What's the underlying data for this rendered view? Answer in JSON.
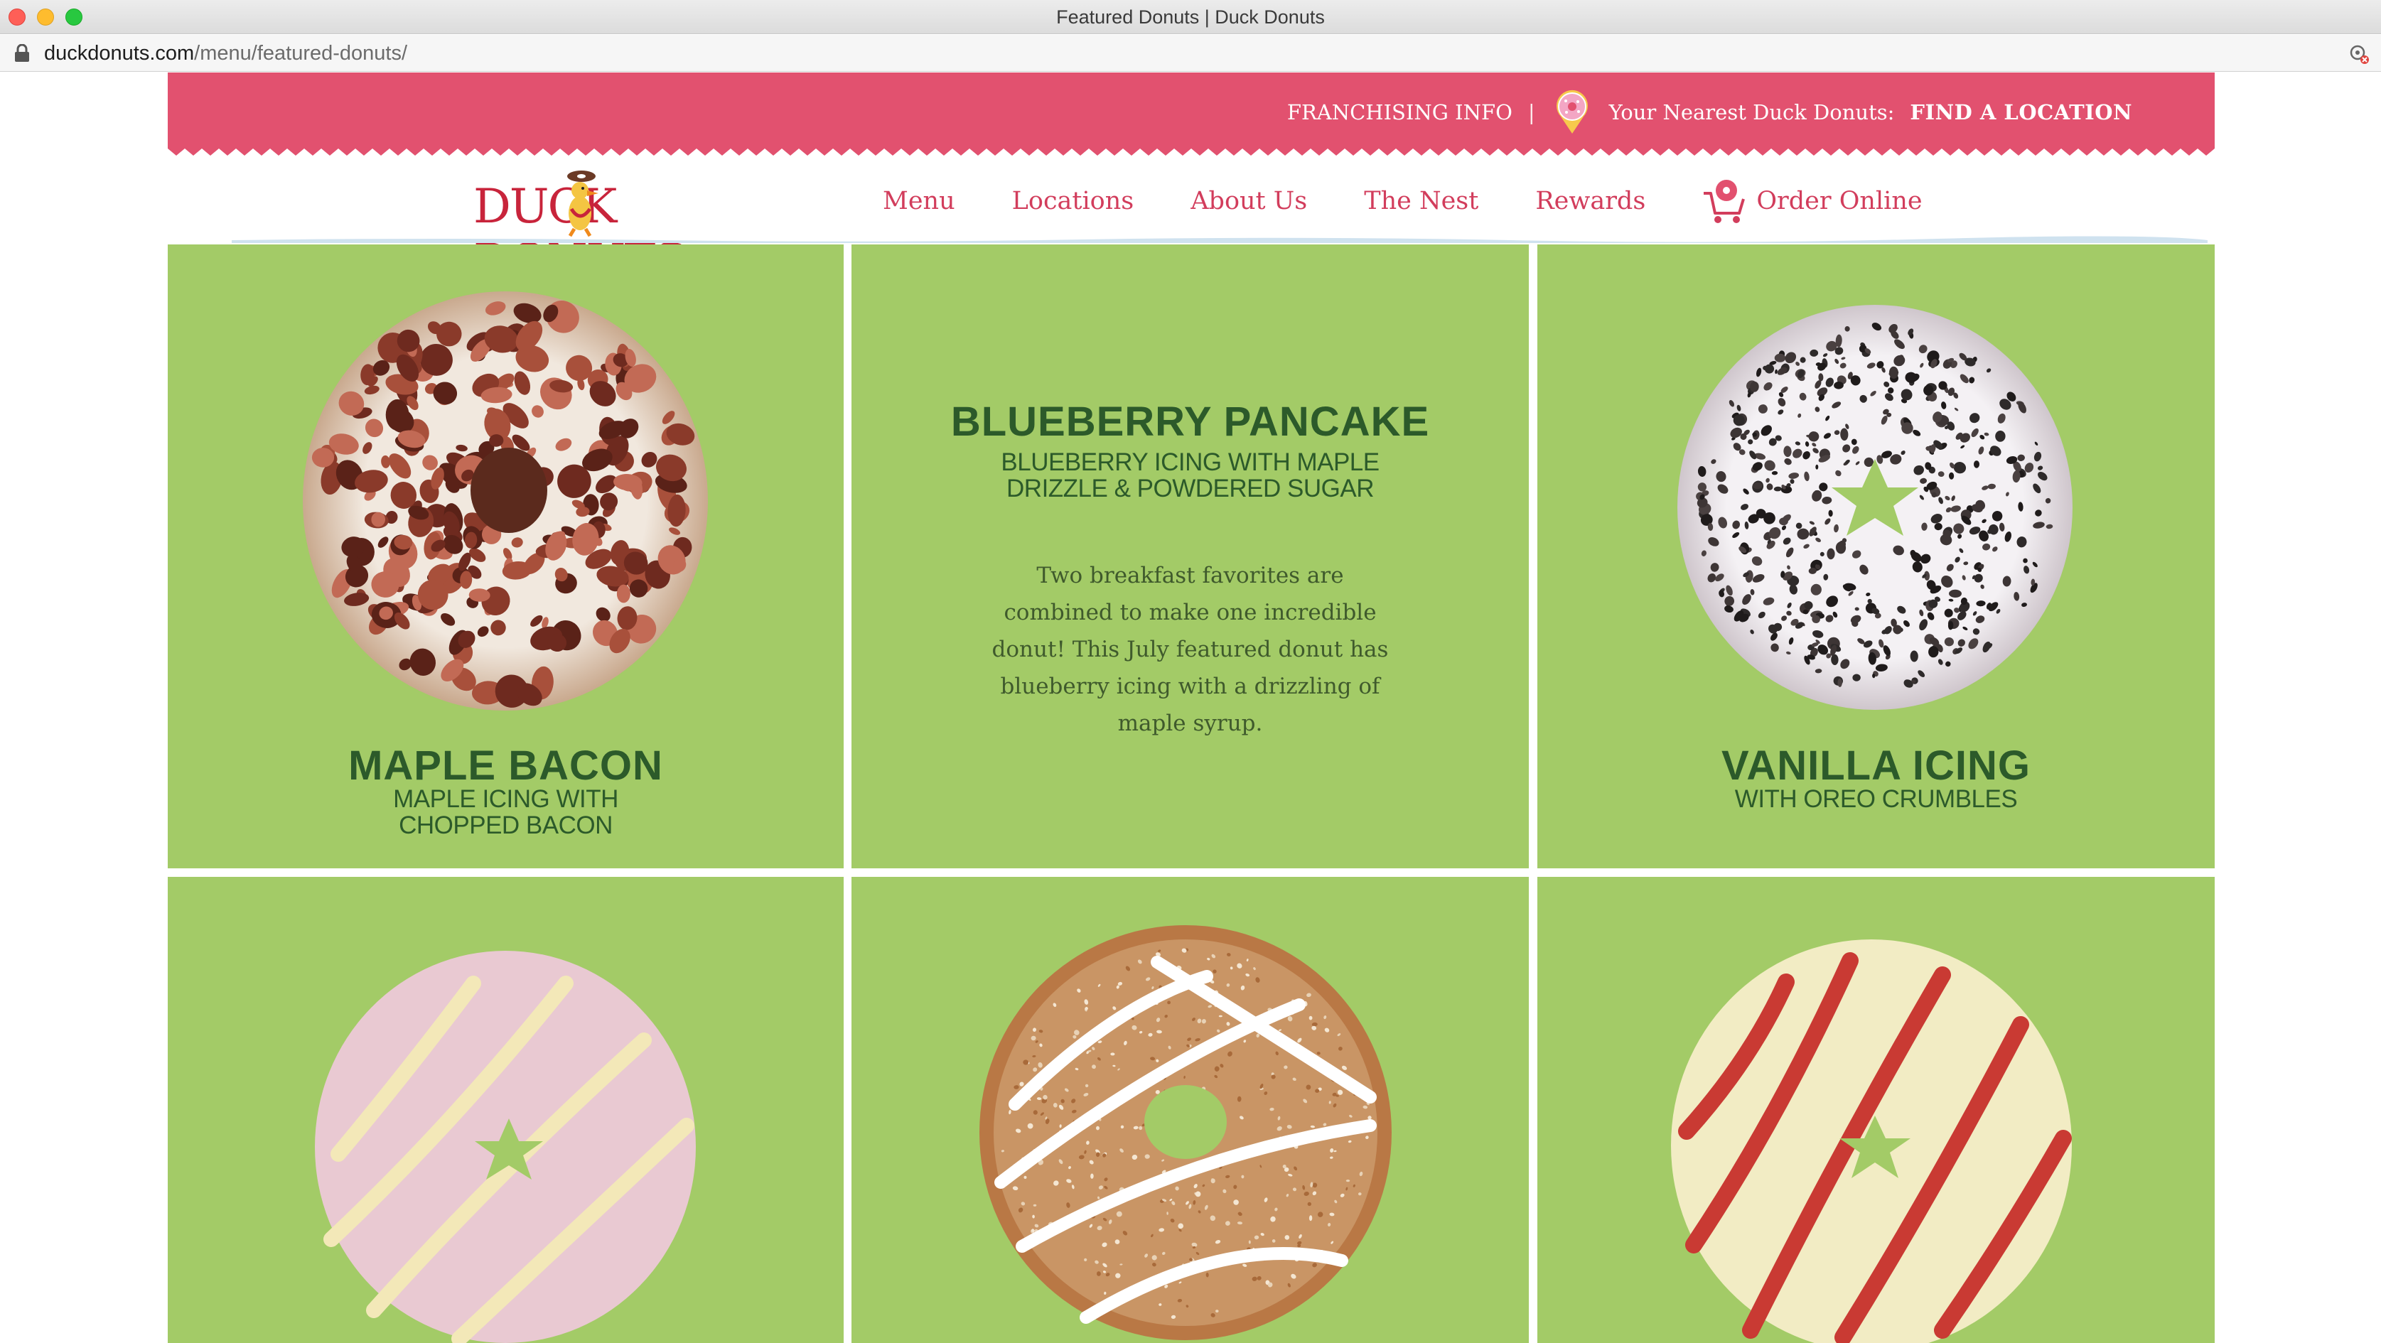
{
  "browser": {
    "window_title": "Featured Donuts | Duck Donuts",
    "url_host": "duckdonuts.com",
    "url_path": "/menu/featured-donuts/"
  },
  "topbar": {
    "franchising": "FRANCHISING INFO",
    "separator": "|",
    "nearest_prefix": "Your Nearest Duck Donuts:",
    "find_location": "FIND A LOCATION",
    "bg_color": "#e2516f"
  },
  "brand": {
    "logo_text": "DUCK DONUTS"
  },
  "nav": {
    "items": [
      "Menu",
      "Locations",
      "About Us",
      "The Nest",
      "Rewards"
    ],
    "order_online": "Order Online",
    "color": "#d23d5c"
  },
  "tiles": {
    "bg_color": "#a3cb67",
    "text_color": "#2c5a2a",
    "maple_bacon": {
      "name": "MAPLE BACON",
      "sub": "MAPLE ICING WITH CHOPPED BACON"
    },
    "blueberry_pancake": {
      "name": "BLUEBERRY PANCAKE",
      "sub": "BLUEBERRY ICING WITH MAPLE DRIZZLE & POWDERED SUGAR",
      "description": "Two breakfast favorites are combined to make one incredible donut! This July featured donut has blueberry icing with a drizzling of maple syrup."
    },
    "vanilla_oreo": {
      "name": "VANILLA ICING",
      "sub": "WITH OREO CRUMBLES"
    }
  }
}
